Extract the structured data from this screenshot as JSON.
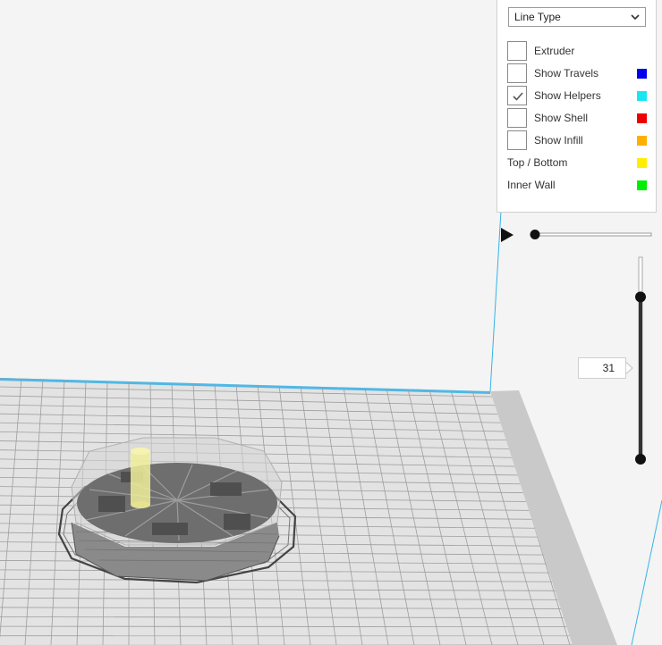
{
  "legend": {
    "line_type_select": {
      "value": "Line Type"
    },
    "rows": [
      {
        "label": "Extruder",
        "checked": false,
        "has_checkbox": true,
        "color": ""
      },
      {
        "label": "Show Travels",
        "checked": false,
        "has_checkbox": true,
        "color": "#0000ee"
      },
      {
        "label": "Show Helpers",
        "checked": true,
        "has_checkbox": true,
        "color": "#19e6f0"
      },
      {
        "label": "Show Shell",
        "checked": false,
        "has_checkbox": true,
        "color": "#ee0000"
      },
      {
        "label": "Show Infill",
        "checked": false,
        "has_checkbox": true,
        "color": "#ffb000"
      },
      {
        "label": "Top / Bottom",
        "has_checkbox": false,
        "color": "#ffee00"
      },
      {
        "label": "Inner Wall",
        "has_checkbox": false,
        "color": "#00ee00"
      }
    ]
  },
  "simulation": {
    "play_icon": "play-icon",
    "progress": 0
  },
  "layer_slider": {
    "current_layer": "31",
    "upper_handle_fraction": 0.82
  },
  "colors": {
    "build_volume_edge": "#35b3e8",
    "grid_line": "#b8b8b8",
    "plate": "#e2e2e2",
    "model": "#7a7a7a",
    "helper_highlight": "#f0ee9a"
  }
}
